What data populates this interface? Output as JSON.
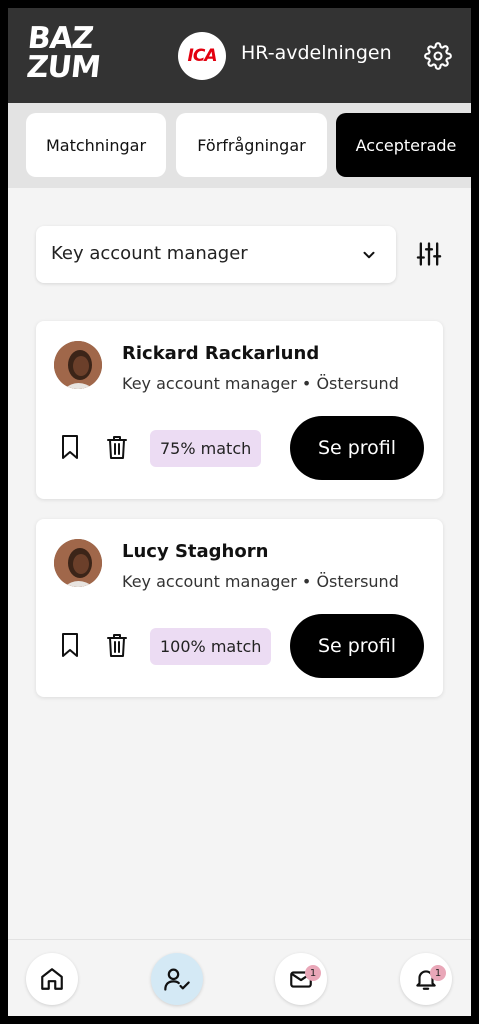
{
  "header": {
    "logo_line1": "BAZ",
    "logo_line2": "ZUM",
    "org_logo_text": "ICA",
    "org_name": "HR-avdelningen"
  },
  "tabs": [
    {
      "label": "Matchningar",
      "active": false
    },
    {
      "label": "Förfrågningar",
      "active": false
    },
    {
      "label": "Accepterade",
      "active": true
    }
  ],
  "filter": {
    "selected": "Key account manager"
  },
  "candidates": [
    {
      "name": "Rickard Rackarlund",
      "subtitle": "Key account manager • Östersund",
      "match": "75% match",
      "button": "Se profil"
    },
    {
      "name": "Lucy Staghorn",
      "subtitle": "Key account manager • Östersund",
      "match": "100% match",
      "button": "Se profil"
    }
  ],
  "bottom_nav": {
    "messages_badge": "1",
    "notifications_badge": "1"
  },
  "colors": {
    "header_bg": "#333333",
    "accent_black": "#000000",
    "match_chip": "#ecdcf3",
    "nav_active": "#d4e9f5",
    "badge": "#e9a7b8",
    "ica_red": "#e3000f"
  }
}
